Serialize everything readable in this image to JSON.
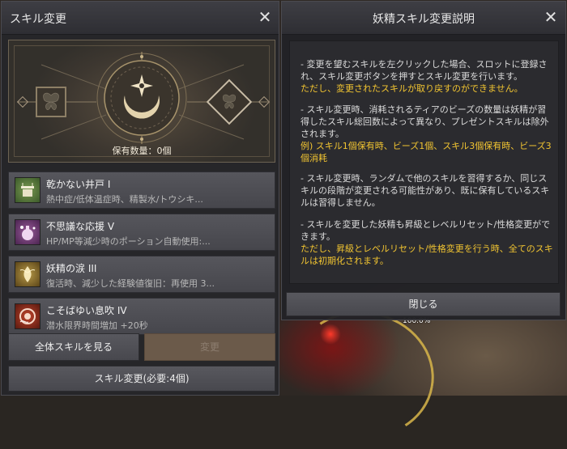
{
  "left_panel": {
    "title": "スキル変更",
    "owned_count": "保有数量：0個",
    "skills": [
      {
        "name": "乾かない井戸 I",
        "desc": "熱中症/低体温症時、精製水/トウシキ..."
      },
      {
        "name": "不思議な応援 V",
        "desc": "HP/MP等減少時のポーション自動使用:..."
      },
      {
        "name": "妖精の涙 III",
        "desc": "復活時、減少した経験値復旧：再使用 3..."
      },
      {
        "name": "こそばゆい息吹 IV",
        "desc": "潜水限界時間増加 +20秒"
      }
    ],
    "view_all_button": "全体スキルを見る",
    "disabled_button": "変更",
    "change_button": "スキル変更(必要:4個)"
  },
  "right_panel": {
    "title": "妖精スキル変更説明",
    "para1": "- 変更を望むスキルを左クリックした場合、スロットに登録され、スキル変更ボタンを押すとスキル変更を行います。",
    "para1_note": "ただし、変更されたスキルが取り戻すのができません。",
    "para2": "- スキル変更時、消耗されるティアのビーズの数量は妖精が習得したスキル総回数によって異なり、プレゼントスキルは除外されます。",
    "para2_note": "例) スキル1個保有時、ビーズ1個、スキル3個保有時、ビーズ3個消耗",
    "para3": "- スキル変更時、ランダムで他のスキルを習得するか、同じスキルの段階が変更される可能性があり、既に保有しているスキルは習得しません。",
    "para4": "- スキルを変更した妖精も昇級とレベルリセット/性格変更ができます。",
    "para4_note": "ただし、昇級とレベルリセット/性格変更を行う時、全てのスキルは初期化されます。",
    "close_button": "閉じる"
  },
  "world": {
    "overlay_text": "100.0%"
  },
  "colors": {
    "highlight": "#f2c531",
    "panel_bg": "#26262a",
    "button_bg": "#505056"
  },
  "icons": [
    "close-icon",
    "butterfly-icon",
    "moon-emblem-icon",
    "water-well-icon",
    "cheer-potion-icon",
    "fairy-tear-icon",
    "breath-icon"
  ]
}
